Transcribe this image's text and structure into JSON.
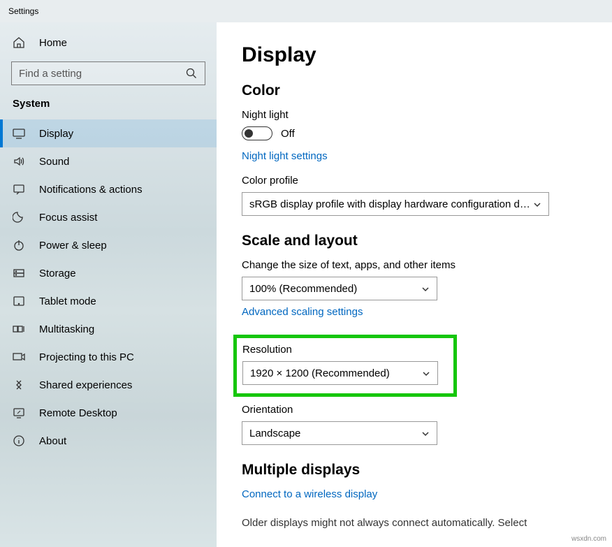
{
  "window": {
    "title": "Settings"
  },
  "sidebar": {
    "home": "Home",
    "search_placeholder": "Find a setting",
    "section": "System",
    "items": [
      {
        "label": "Display",
        "selected": true
      },
      {
        "label": "Sound"
      },
      {
        "label": "Notifications & actions"
      },
      {
        "label": "Focus assist"
      },
      {
        "label": "Power & sleep"
      },
      {
        "label": "Storage"
      },
      {
        "label": "Tablet mode"
      },
      {
        "label": "Multitasking"
      },
      {
        "label": "Projecting to this PC"
      },
      {
        "label": "Shared experiences"
      },
      {
        "label": "Remote Desktop"
      },
      {
        "label": "About"
      }
    ]
  },
  "page": {
    "title": "Display",
    "color": {
      "heading": "Color",
      "night_label": "Night light",
      "night_status": "Off",
      "night_link": "Night light settings",
      "profile_label": "Color profile",
      "profile_value": "sRGB display profile with display hardware configuration d…"
    },
    "scale": {
      "heading": "Scale and layout",
      "size_label": "Change the size of text, apps, and other items",
      "size_value": "100% (Recommended)",
      "adv_link": "Advanced scaling settings",
      "res_label": "Resolution",
      "res_value": "1920 × 1200 (Recommended)",
      "orient_label": "Orientation",
      "orient_value": "Landscape"
    },
    "multi": {
      "heading": "Multiple displays",
      "link": "Connect to a wireless display",
      "note": "Older displays might not always connect automatically. Select"
    }
  },
  "watermark": "wsxdn.com"
}
